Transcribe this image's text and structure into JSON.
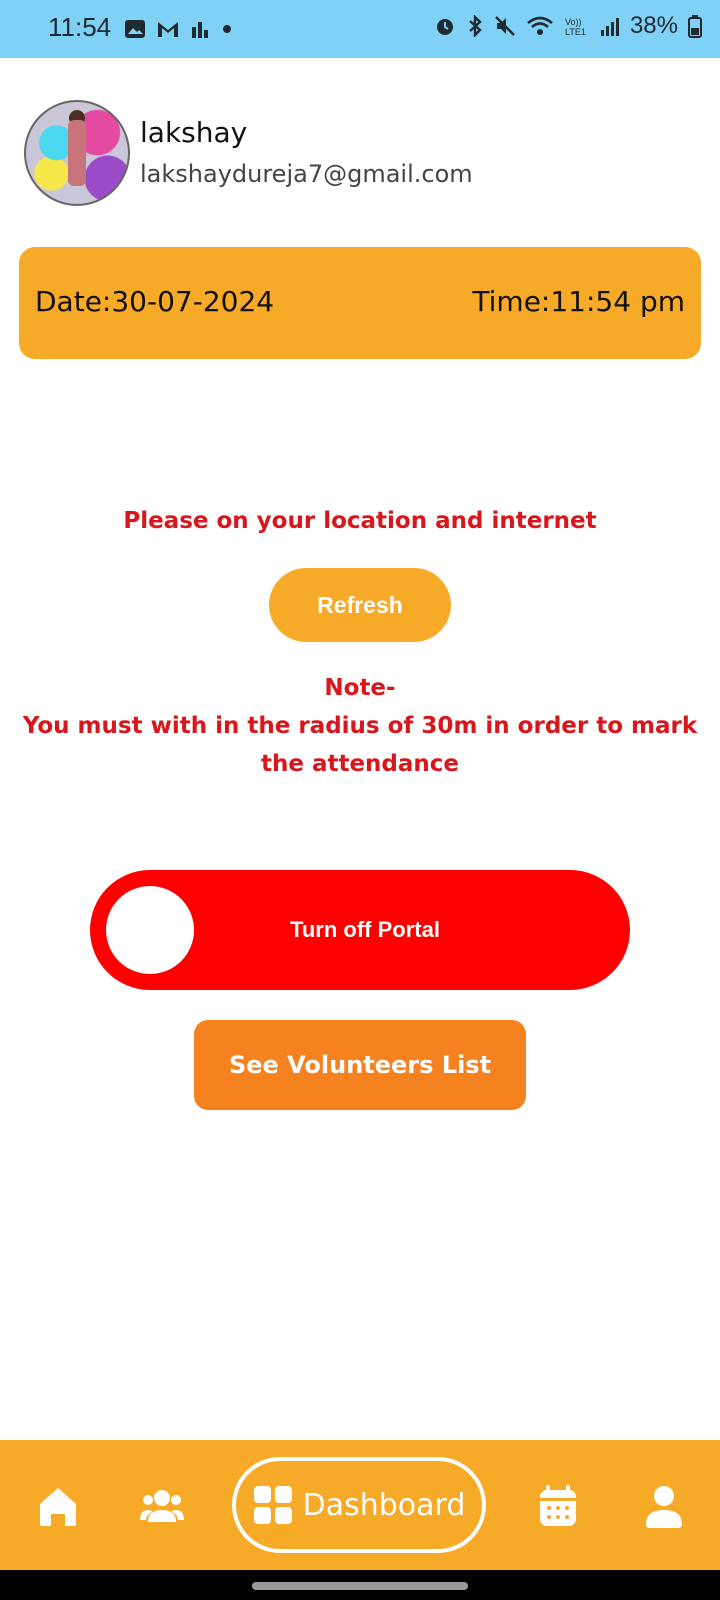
{
  "status_bar": {
    "time": "11:54",
    "battery": "38%",
    "left_icons": [
      "image-icon",
      "gmail-icon",
      "stats-icon",
      "dot-icon"
    ],
    "right_icons": [
      "alarm-icon",
      "bluetooth-icon",
      "mute-icon",
      "wifi-icon",
      "volte-icon",
      "signal-icon",
      "battery-icon"
    ]
  },
  "profile": {
    "name": "lakshay",
    "email": "lakshaydureja7@gmail.com"
  },
  "date_card": {
    "date": "Date:30-07-2024",
    "time": "Time:11:54 pm"
  },
  "messages": {
    "location_warning": "Please on your location and internet",
    "note_title": "Note-",
    "note_line1": "You must with in the radius of 30m in order to mark",
    "note_line2": "the attendance"
  },
  "buttons": {
    "refresh": "Refresh",
    "portal_toggle": "Turn off Portal",
    "volunteers": "See Volunteers List"
  },
  "bottom_nav": {
    "active_label": "Dashboard",
    "items": [
      "home-icon",
      "group-icon",
      "dashboard-icon",
      "calendar-icon",
      "person-icon"
    ]
  },
  "colors": {
    "status_bar": "#7fd1f5",
    "accent": "#f7a928",
    "danger": "#ff0000",
    "warning_text": "#d8161c",
    "secondary_button": "#f5821f"
  }
}
